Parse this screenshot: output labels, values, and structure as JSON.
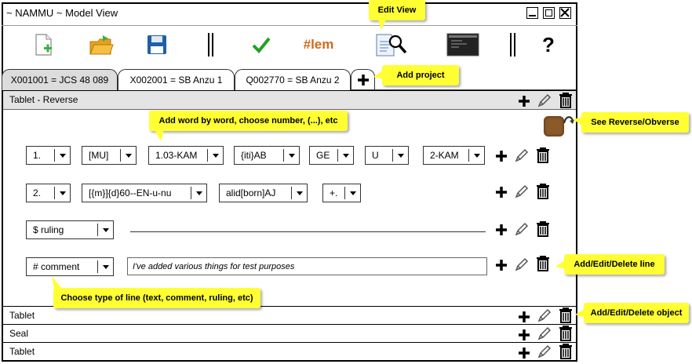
{
  "window": {
    "title": "~ NAMMU ~ Model View"
  },
  "toolbar": {
    "lem_label": "#lem",
    "help_label": "?"
  },
  "tabs": [
    {
      "label": "X001001 = JCS 48 089"
    },
    {
      "label": "X002001 = SB Anzu 1"
    },
    {
      "label": "Q002770 = SB Anzu 2"
    }
  ],
  "object_header": {
    "label": "Tablet - Reverse"
  },
  "lines": [
    {
      "type": "1.",
      "words": [
        "[MU]",
        "1.03-KAM",
        "{iti}AB",
        "GE",
        "U",
        "2-KAM"
      ]
    },
    {
      "type": "2.",
      "words": [
        "[{m}]{d}60--EN-u-nu",
        "alid[born]AJ",
        "+."
      ]
    },
    {
      "type": "$ ruling"
    },
    {
      "type": "# comment",
      "comment": "I've added various things for test purposes"
    }
  ],
  "objects": [
    {
      "label": "Tablet"
    },
    {
      "label": "Seal"
    },
    {
      "label": "Tablet"
    }
  ],
  "notes": {
    "edit_view": "Edit View",
    "add_project": "Add project",
    "add_word": "Add word by word, choose number, (...), etc",
    "see_reverse": "See Reverse/Obverse",
    "choose_type": "Choose type of line (text, comment, ruling, etc)",
    "add_edit_line": "Add/Edit/Delete line",
    "add_edit_object": "Add/Edit/Delete object"
  },
  "colors": {
    "note_bg": "#ffff33",
    "check": "#22a022",
    "lem": "#d2691e",
    "folder": "#e8a020",
    "save": "#1f5fa8"
  }
}
